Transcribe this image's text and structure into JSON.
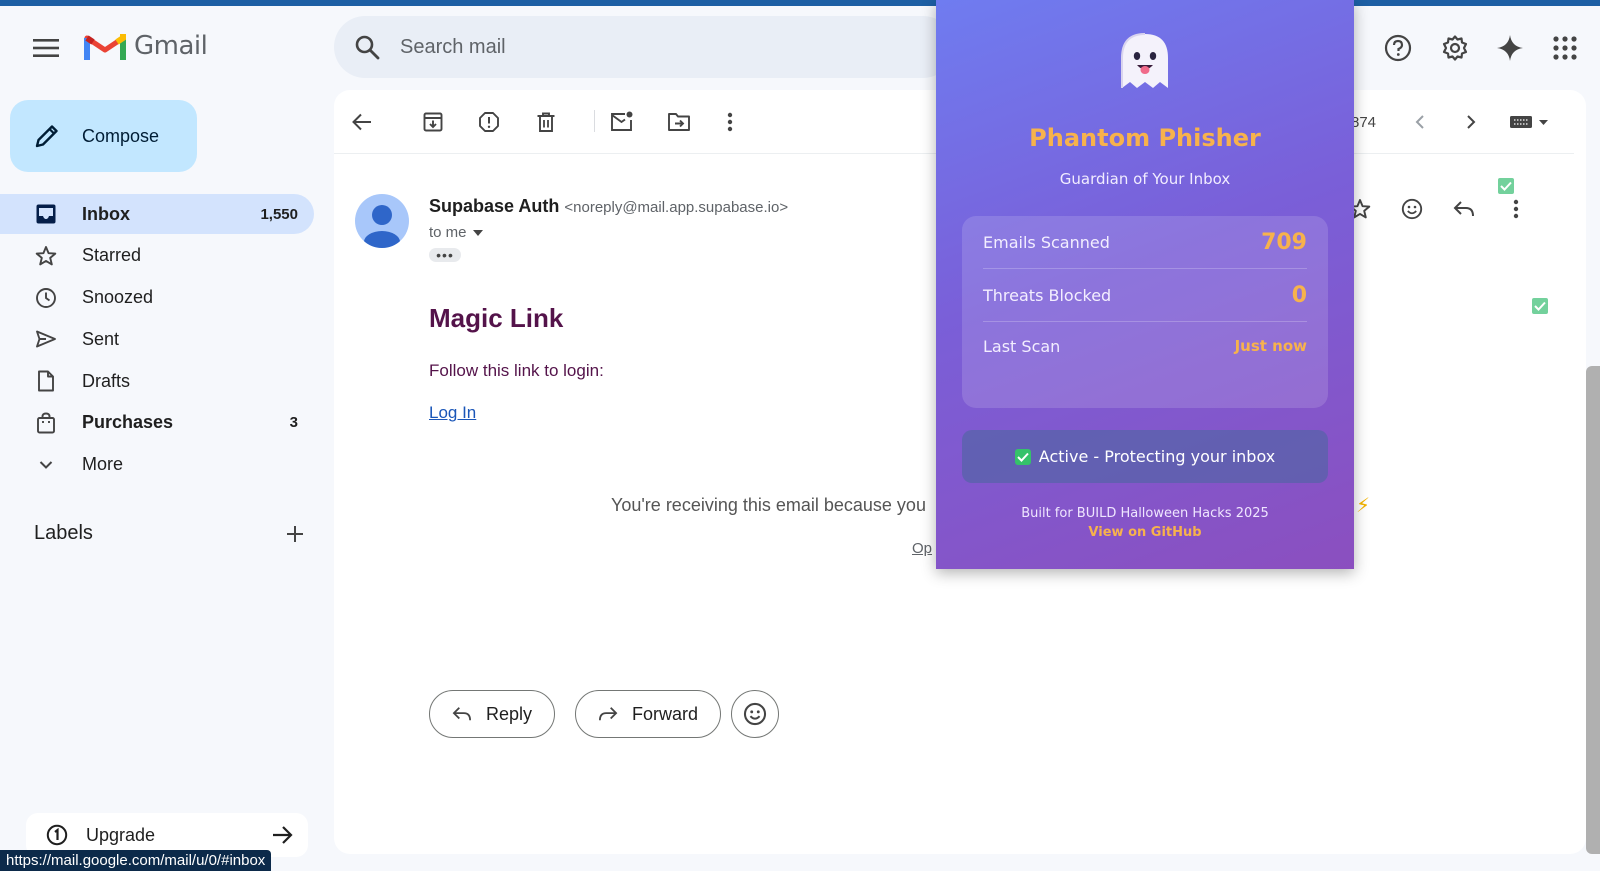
{
  "header": {
    "app_name": "Gmail",
    "search_placeholder": "Search mail"
  },
  "sidebar": {
    "compose_label": "Compose",
    "items": [
      {
        "label": "Inbox",
        "count": "1,550"
      },
      {
        "label": "Starred",
        "count": ""
      },
      {
        "label": "Snoozed",
        "count": ""
      },
      {
        "label": "Sent",
        "count": ""
      },
      {
        "label": "Drafts",
        "count": ""
      },
      {
        "label": "Purchases",
        "count": "3"
      },
      {
        "label": "More",
        "count": ""
      }
    ],
    "labels_heading": "Labels",
    "upgrade_label": "Upgrade"
  },
  "toolbar": {
    "count_text": "874"
  },
  "email": {
    "sender_name": "Supabase Auth",
    "sender_addr": "<noreply@mail.app.supabase.io>",
    "to_line": "to me",
    "ellipsis": "•••",
    "title": "Magic Link",
    "body_line": "Follow this link to login:",
    "link_text": "Log In",
    "footer_text": "You're receiving this email because you",
    "footer_link": "Op"
  },
  "actions": {
    "reply_label": "Reply",
    "forward_label": "Forward"
  },
  "status_bar": {
    "url": "https://mail.google.com/mail/u/0/#inbox"
  },
  "extension": {
    "title": "Phantom Phisher",
    "subtitle": "Guardian of Your Inbox",
    "stats": [
      {
        "label": "Emails Scanned",
        "value": "709"
      },
      {
        "label": "Threats Blocked",
        "value": "0"
      },
      {
        "label": "Last Scan",
        "value": "Just now"
      }
    ],
    "status_text": "Active - Protecting your inbox",
    "built_for": "Built for BUILD Halloween Hacks 2025",
    "github_link": "View on GitHub"
  },
  "colors": {
    "accent": "#c2e7ff",
    "active_nav": "#d3e3fd",
    "email_title": "#54134a",
    "extension_highlight": "#f7b24c"
  },
  "icons": {
    "menu": "hamburger-icon",
    "search": "search-icon",
    "help": "help-icon",
    "settings": "gear-icon",
    "gemini": "sparkle-icon",
    "apps": "apps-grid-icon"
  }
}
